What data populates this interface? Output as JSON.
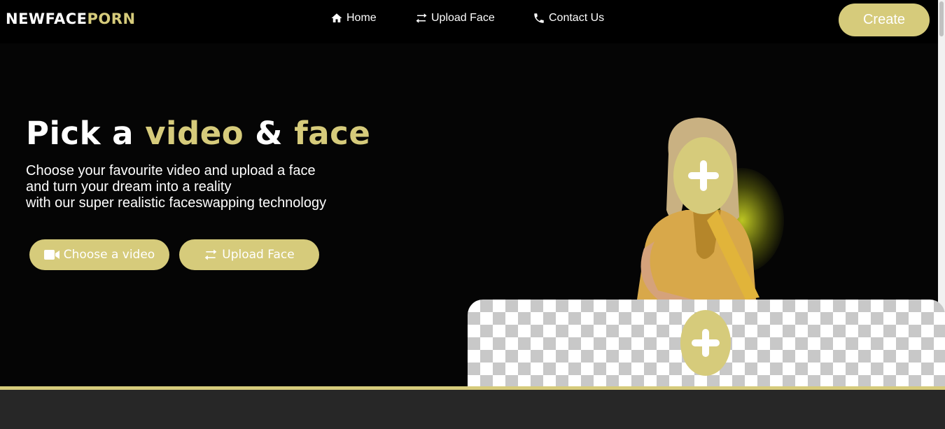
{
  "brand": {
    "part1": "NEWFACE",
    "part2": "PORN"
  },
  "nav": {
    "home": {
      "label": "Home",
      "icon": "home-icon"
    },
    "upload": {
      "label": "Upload Face",
      "icon": "swap-icon"
    },
    "contact": {
      "label": "Contact Us",
      "icon": "phone-icon"
    }
  },
  "create_label": "Create",
  "hero": {
    "title_1": "Pick a",
    "title_2": "video",
    "title_3": "&",
    "title_4": "face",
    "line_1": "Choose your favourite video and upload a face",
    "line_2": "and turn your dream into a reality",
    "line_3": "with our super realistic faceswapping technology",
    "btn_video": "Choose a video",
    "btn_upload": "Upload Face"
  },
  "colors": {
    "accent": "#d6cb7b",
    "background": "#050505",
    "footer": "#272727"
  }
}
